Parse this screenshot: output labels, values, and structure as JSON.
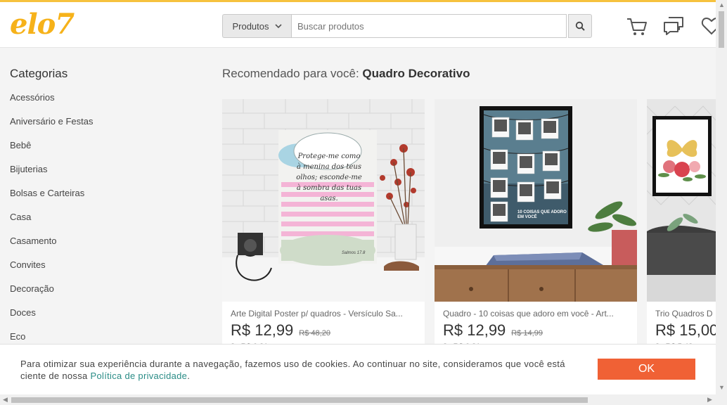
{
  "header": {
    "logo": "elo7",
    "search": {
      "dropdown_label": "Produtos",
      "placeholder": "Buscar produtos"
    },
    "icons": [
      "cart-icon",
      "chat-icon",
      "heart-icon"
    ]
  },
  "sidebar": {
    "title": "Categorias",
    "items": [
      "Acessórios",
      "Aniversário e Festas",
      "Bebê",
      "Bijuterias",
      "Bolsas e Carteiras",
      "Casa",
      "Casamento",
      "Convites",
      "Decoração",
      "Doces",
      "Eco"
    ]
  },
  "recommend": {
    "prefix": "Recomendado para você:",
    "topic": "Quadro Decorativo"
  },
  "products": [
    {
      "title": "Arte Digital Poster p/ quadros - Versículo Sa...",
      "price": "R$ 12,99",
      "old_price": "R$ 48,20",
      "installments": "2x R$ 6,81",
      "poster_text": "Protege-me como à menina dos teus olhos; esconde-me à sombra das tuas asas.",
      "poster_ref": "Salmos 17.8"
    },
    {
      "title": "Quadro - 10 coisas que adoro em você - Art...",
      "price": "R$ 12,99",
      "old_price": "R$ 14,99",
      "installments": "2x R$ 6,81",
      "poster_text": "10 COISAS QUE ADORO EM VOCÊ"
    },
    {
      "title": "Trio Quadros D",
      "price": "R$ 15,00",
      "installments": "3x R$ 5,42"
    }
  ],
  "cookie": {
    "message": "Para otimizar sua experiência durante a navegação, fazemos uso de cookies. Ao continuar no site, consideramos que você está ciente de nossa",
    "link": "Política de privacidade",
    "end": ".",
    "button": "OK"
  },
  "colors": {
    "brand": "#f6b21a",
    "ok_button": "#f06135",
    "link": "#2a8c86"
  }
}
